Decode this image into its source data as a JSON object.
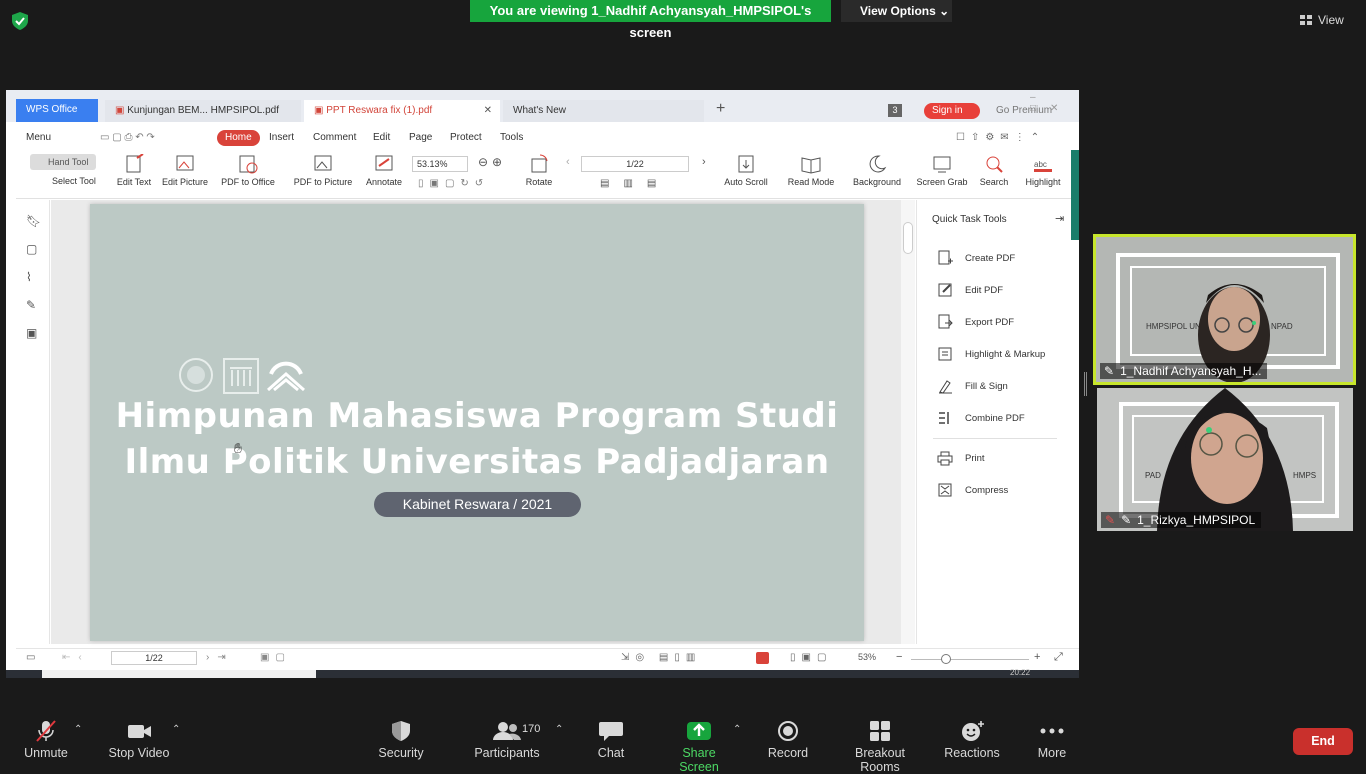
{
  "top_bar": {
    "viewing_banner": "You are viewing 1_Nadhif Achyansyah_HMPSIPOL's screen",
    "view_options": "View Options",
    "view": "View"
  },
  "wps": {
    "tabs": [
      "WPS Office",
      "Kunjungan BEM... HMPSIPOL.pdf",
      "PPT Reswara fix (1).pdf",
      "What's New"
    ],
    "badge": "3",
    "sign_in": "Sign in",
    "go_premium": "Go Premium",
    "menu": [
      "Menu",
      "Home",
      "Insert",
      "Comment",
      "Edit",
      "Page",
      "Protect",
      "Tools"
    ],
    "hand_tool": "Hand Tool",
    "select_tool": "Select Tool",
    "tools": [
      "Edit Text",
      "Edit Picture",
      "PDF to Office",
      "PDF to Picture",
      "Annotate",
      "Rotate",
      "Auto Scroll",
      "Read Mode",
      "Background",
      "Screen Grab",
      "Search",
      "Highlight"
    ],
    "zoom": "53.13%",
    "page": "1/22",
    "quick_tools_title": "Quick Task Tools",
    "quick_tools": [
      "Create PDF",
      "Edit PDF",
      "Export PDF",
      "Highlight & Markup",
      "Fill & Sign",
      "Combine PDF",
      "Print",
      "Compress"
    ],
    "status_page": "1/22",
    "status_zoom": "53%",
    "clock": "20:22"
  },
  "slide": {
    "title_line1": "Himpunan Mahasiswa Program Studi",
    "title_line2": "Ilmu Politik Universitas Padjadjaran",
    "subtitle": "Kabinet Reswara / 2021"
  },
  "participants_video": [
    {
      "name": "1_Nadhif Achyansyah_H..."
    },
    {
      "name": "1_Rizkya_HMPSIPOL"
    }
  ],
  "bottom_bar": {
    "unmute": "Unmute",
    "stop_video": "Stop Video",
    "security": "Security",
    "participants": "Participants",
    "participant_count": "170",
    "chat": "Chat",
    "share_screen": "Share Screen",
    "record": "Record",
    "breakout_rooms": "Breakout Rooms",
    "reactions": "Reactions",
    "more": "More",
    "end": "End"
  },
  "colors": {
    "share_green": "#17a53d",
    "wps_red": "#d9433a",
    "active_speaker": "#c7e62c",
    "end_red": "#c9302c",
    "slide_bg": "#bcc9c5"
  }
}
